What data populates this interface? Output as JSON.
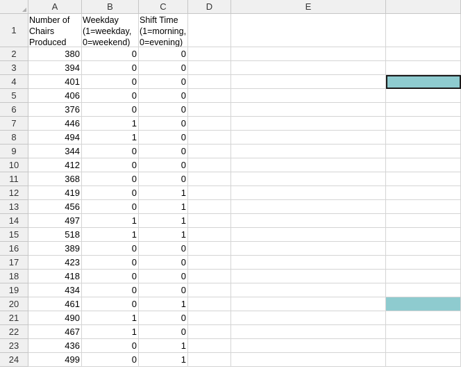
{
  "columns": [
    "A",
    "B",
    "C",
    "D",
    "E"
  ],
  "row_numbers": [
    "1",
    "2",
    "3",
    "4",
    "5",
    "6",
    "7",
    "8",
    "9",
    "10",
    "11",
    "12",
    "13",
    "14",
    "15",
    "16",
    "17",
    "18",
    "19",
    "20",
    "21",
    "22",
    "23",
    "24"
  ],
  "headers": {
    "A": "Number of Chairs Produced",
    "B": "Weekday (1=weekday, 0=weekend)",
    "C": "Shift Time (1=morning, 0=evening)"
  },
  "rows": [
    [
      "380",
      "0",
      "0"
    ],
    [
      "394",
      "0",
      "0"
    ],
    [
      "401",
      "0",
      "0"
    ],
    [
      "406",
      "0",
      "0"
    ],
    [
      "376",
      "0",
      "0"
    ],
    [
      "446",
      "1",
      "0"
    ],
    [
      "494",
      "1",
      "0"
    ],
    [
      "344",
      "0",
      "0"
    ],
    [
      "412",
      "0",
      "0"
    ],
    [
      "368",
      "0",
      "0"
    ],
    [
      "419",
      "0",
      "1"
    ],
    [
      "456",
      "0",
      "1"
    ],
    [
      "497",
      "1",
      "1"
    ],
    [
      "518",
      "1",
      "1"
    ],
    [
      "389",
      "0",
      "0"
    ],
    [
      "423",
      "0",
      "0"
    ],
    [
      "418",
      "0",
      "0"
    ],
    [
      "434",
      "0",
      "0"
    ],
    [
      "461",
      "0",
      "1"
    ],
    [
      "490",
      "1",
      "0"
    ],
    [
      "467",
      "1",
      "0"
    ],
    [
      "436",
      "0",
      "1"
    ],
    [
      "499",
      "0",
      "1"
    ]
  ],
  "highlight_color": "#8ecbcf",
  "highlighted_rows": [
    "4",
    "20"
  ],
  "selected_row": "4"
}
